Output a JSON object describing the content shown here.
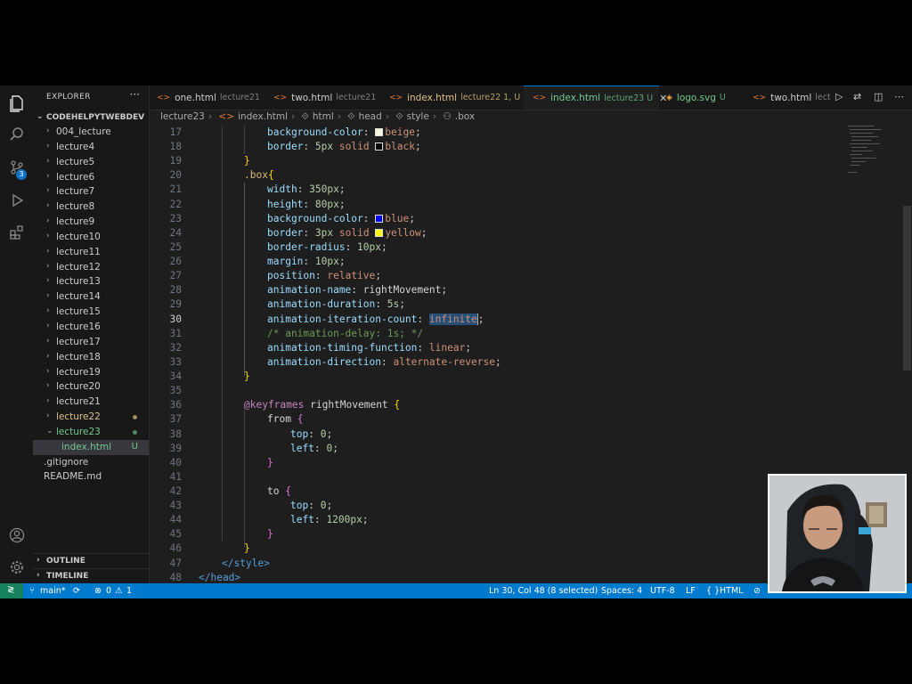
{
  "sidebar": {
    "title": "EXPLORER",
    "root": "CODEHELPYTWEBDEV",
    "items": [
      {
        "label": "004_lecture"
      },
      {
        "label": "lecture4"
      },
      {
        "label": "lecture5"
      },
      {
        "label": "lecture6"
      },
      {
        "label": "lecture7"
      },
      {
        "label": "lecture8"
      },
      {
        "label": "lecture9"
      },
      {
        "label": "lecture10"
      },
      {
        "label": "lecture11"
      },
      {
        "label": "lecture12"
      },
      {
        "label": "lecture13"
      },
      {
        "label": "lecture14"
      },
      {
        "label": "lecture15"
      },
      {
        "label": "lecture16"
      },
      {
        "label": "lecture17"
      },
      {
        "label": "lecture18"
      },
      {
        "label": "lecture19"
      },
      {
        "label": "lecture20"
      },
      {
        "label": "lecture21"
      },
      {
        "label": "lecture22"
      },
      {
        "label": "lecture23"
      },
      {
        "label": "index.html",
        "badge": "U"
      },
      {
        "label": ".gitignore"
      },
      {
        "label": "README.md"
      }
    ],
    "outline": "OUTLINE",
    "timeline": "TIMELINE",
    "scm_badge": "3"
  },
  "tabs": [
    {
      "name": "one.html",
      "dir": "lecture21"
    },
    {
      "name": "two.html",
      "dir": "lecture21"
    },
    {
      "name": "index.html",
      "dir": "lecture22 1, U"
    },
    {
      "name": "index.html",
      "dir": "lecture23 U"
    },
    {
      "name": "logo.svg",
      "dir": "U"
    },
    {
      "name": "two.html",
      "dir": "lecture"
    }
  ],
  "breadcrumb": [
    "lecture23",
    "index.html",
    "html",
    "head",
    "style",
    ".box"
  ],
  "editor": {
    "line_numbers": [
      "17",
      "18",
      "19",
      "20",
      "21",
      "22",
      "23",
      "24",
      "25",
      "26",
      "27",
      "28",
      "29",
      "30",
      "31",
      "32",
      "33",
      "34",
      "35",
      "36",
      "37",
      "38",
      "39",
      "40",
      "41",
      "42",
      "43",
      "44",
      "45",
      "46",
      "47",
      "48"
    ],
    "l17": {
      "prop": "background-color",
      "val": "beige"
    },
    "l18": {
      "prop": "border",
      "v1": "5px",
      "v2": "solid",
      "val": "black"
    },
    "l20": {
      "sel": ".box"
    },
    "l21": {
      "prop": "width",
      "val": "350px"
    },
    "l22": {
      "prop": "height",
      "val": "80px"
    },
    "l23": {
      "prop": "background-color",
      "val": "blue"
    },
    "l24": {
      "prop": "border",
      "v1": "3px",
      "v2": "solid",
      "val": "yellow"
    },
    "l25": {
      "prop": "border-radius",
      "val": "10px"
    },
    "l26": {
      "prop": "margin",
      "val": "10px"
    },
    "l27": {
      "prop": "position",
      "val": "relative"
    },
    "l28": {
      "prop": "animation-name",
      "val": "rightMovement"
    },
    "l29": {
      "prop": "animation-duration",
      "val": "5s"
    },
    "l30": {
      "prop": "animation-iteration-count",
      "val": "infinite"
    },
    "l31": {
      "comment": "/* animation-delay: 1s; */"
    },
    "l32": {
      "prop": "animation-timing-function",
      "val": "linear"
    },
    "l33": {
      "prop": "animation-direction",
      "val": "alternate-reverse"
    },
    "l36": {
      "at": "@keyframes",
      "name": "rightMovement"
    },
    "l37": {
      "kw": "from"
    },
    "l38": {
      "prop": "top",
      "val": "0"
    },
    "l39": {
      "prop": "left",
      "val": "0"
    },
    "l42": {
      "kw": "to"
    },
    "l43": {
      "prop": "top",
      "val": "0"
    },
    "l44": {
      "prop": "left",
      "val": "1200px"
    },
    "l47": {
      "tag": "</style>"
    },
    "l48": {
      "tag": "</head>"
    }
  },
  "status": {
    "branch": "main*",
    "errors": "0",
    "warnings": "1",
    "position": "Ln 30, Col 48 (8 selected)",
    "spaces": "Spaces: 4",
    "encoding": "UTF-8",
    "eol": "LF",
    "language": "HTML"
  },
  "colors": {
    "beige": "#f5f5dc",
    "black": "#000000",
    "blue": "#0000ff",
    "yellow": "#ffff00",
    "status_bar": "#007acc",
    "git_added": "#73c991"
  }
}
